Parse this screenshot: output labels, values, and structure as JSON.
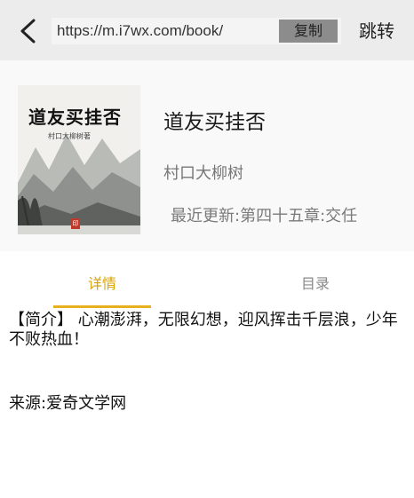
{
  "toolbar": {
    "url_value": "https://m.i7wx.com/book/",
    "copy_label": "复制",
    "jump_label": "跳转"
  },
  "book": {
    "cover_title": "道友买挂否",
    "cover_author": "村口大柳树著",
    "cover_badge": "印",
    "title": "道友买挂否",
    "author": "村口大柳树",
    "latest_update": "最近更新:第四十五章:交任"
  },
  "tabs": [
    {
      "label": "详情",
      "active": true
    },
    {
      "label": "目录",
      "active": false
    }
  ],
  "detail": {
    "intro": "【简介】  心潮澎湃，无限幻想，迎风挥击千层浪，少年不败热血！",
    "source": "来源:爱奇文学网"
  },
  "colors": {
    "accent": "#e7b01c",
    "toolbar_bg": "#ececec",
    "copy_btn_bg": "#8c8c8c"
  },
  "icons": {
    "back": "chevron-left-icon"
  }
}
